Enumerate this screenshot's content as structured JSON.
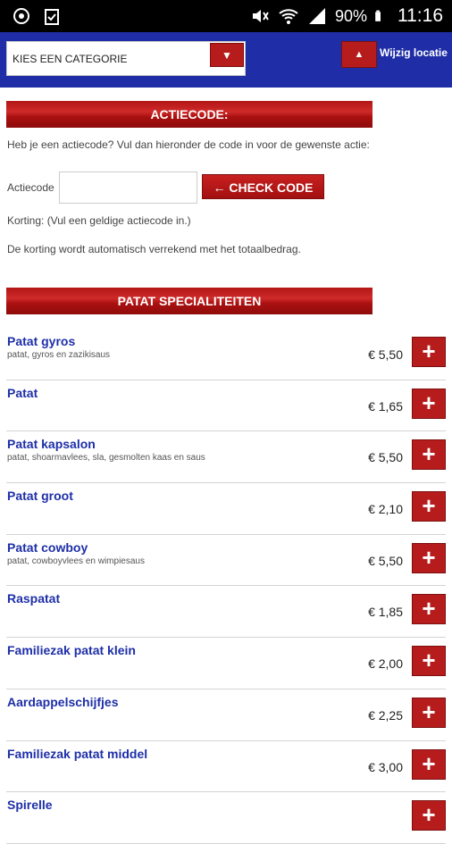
{
  "status_bar": {
    "battery": "90%",
    "time": "11:16"
  },
  "header": {
    "category_select": {
      "value": "KIES EEN CATEGORIE"
    },
    "location_label": "Wijzig locatie"
  },
  "promo": {
    "title": "ACTIECODE:",
    "intro": "Heb je een actiecode? Vul dan hieronder de code in voor de gewenste actie:",
    "code_label": "Actiecode",
    "code_value": "",
    "check_label": "← CHECK CODE",
    "discount_text": "Korting: (Vul een geldige actiecode in.)",
    "note": "De korting wordt automatisch verrekend met het totaalbedrag."
  },
  "section": {
    "title": "PATAT SPECIALITEITEN"
  },
  "menu_items": [
    {
      "name": "Patat gyros",
      "desc": "patat, gyros en zazikisaus",
      "price": "€ 5,50"
    },
    {
      "name": "Patat",
      "desc": "",
      "price": "€ 1,65"
    },
    {
      "name": "Patat kapsalon",
      "desc": "patat, shoarmavlees, sla, gesmolten kaas en saus",
      "price": "€ 5,50"
    },
    {
      "name": "Patat groot",
      "desc": "",
      "price": "€ 2,10"
    },
    {
      "name": "Patat cowboy",
      "desc": "patat, cowboyvlees en wimpiesaus",
      "price": "€ 5,50"
    },
    {
      "name": "Raspatat",
      "desc": "",
      "price": "€ 1,85"
    },
    {
      "name": "Familiezak patat klein",
      "desc": "",
      "price": "€ 2,00"
    },
    {
      "name": "Aardappelschijfjes",
      "desc": "",
      "price": "€ 2,25"
    },
    {
      "name": "Familiezak patat middel",
      "desc": "",
      "price": "€ 3,00"
    },
    {
      "name": "Spirelle",
      "desc": "",
      "price": ""
    }
  ],
  "add_label": "+",
  "colors": {
    "brand_blue": "#1f2ea6",
    "accent_red": "#b71c1c",
    "link_blue": "#1e2fa8"
  },
  "icons": [
    "sync-icon",
    "clipboard-icon",
    "mute-icon",
    "wifi-icon",
    "signal-icon",
    "battery-icon",
    "dropdown-arrow-icon",
    "up-arrow-icon",
    "plus-icon"
  ]
}
